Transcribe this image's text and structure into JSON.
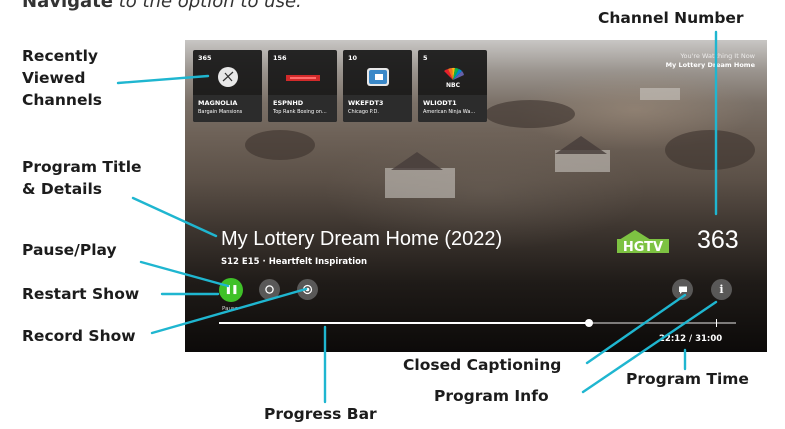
{
  "top": {
    "bold": "Navigate",
    "rest": " to the option to use."
  },
  "labels": {
    "channel_number": "Channel Number",
    "recently_line1": "Recently",
    "recently_line2": "Viewed",
    "recently_line3": "Channels",
    "program_title_line1": "Program Title",
    "program_title_line2": "& Details",
    "pause_play": "Pause/Play",
    "restart_show": "Restart Show",
    "record_show": "Record Show",
    "closed_captioning": "Closed Captioning",
    "program_info": "Program Info",
    "program_time": "Program Time",
    "progress_bar": "Progress Bar"
  },
  "recent_channels": [
    {
      "number": "365",
      "name": "MAGNOLIA",
      "show": "Bargain Mansions",
      "logo_icon": "magnolia-logo"
    },
    {
      "number": "156",
      "name": "ESPNHD",
      "show": "Top Rank Boxing on...",
      "logo_icon": "espn-logo"
    },
    {
      "number": "10",
      "name": "WKEFDT3",
      "show": "Chicago P.D.",
      "logo_icon": "metv-logo"
    },
    {
      "number": "5",
      "name": "WLIODT1",
      "show": "American Ninja Wa...",
      "logo_icon": "nbc-peacock-logo"
    }
  ],
  "now_watching": {
    "line1": "You're Watching It Now",
    "line2": "My Lottery Dream Home"
  },
  "program": {
    "title": "My Lottery Dream Home  (2022)",
    "details": "S12 E15 · Heartfelt Inspiration",
    "network_logo": "HGTV",
    "channel": "363",
    "pause_label": "Pause",
    "elapsed": "22:12",
    "separator": " / ",
    "duration": "31:00",
    "progress": 0.716
  },
  "colors": {
    "accent_green": "#3fc128",
    "callout_blue": "#1fb6d0",
    "hgtv_green": "#7dc242"
  }
}
